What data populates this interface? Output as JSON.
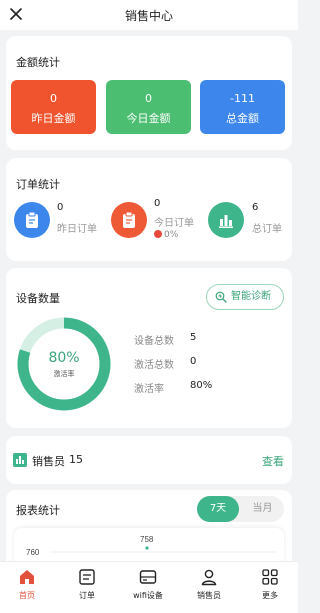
{
  "header": {
    "title": "销售中心"
  },
  "amount": {
    "title": "金额统计",
    "items": [
      {
        "value": "0",
        "label": "昨日金额",
        "color": "#f0542e"
      },
      {
        "value": "0",
        "label": "今日金额",
        "color": "#4cbe72"
      },
      {
        "value": "-111",
        "label": "总金额",
        "color": "#3c86ec"
      }
    ]
  },
  "orders": {
    "title": "订单统计",
    "items": [
      {
        "value": "0",
        "label": "昨日订单",
        "color": "#3c86ec",
        "icon": "clipboard-icon"
      },
      {
        "value": "0",
        "label": "今日订单",
        "color": "#ee5a35",
        "icon": "clipboard-icon",
        "change": "0%"
      },
      {
        "value": "6",
        "label": "总订单",
        "color": "#3eb58b",
        "icon": "bar-chart-icon"
      }
    ]
  },
  "devices": {
    "title": "设备数量",
    "diagnose_label": "智能诊断",
    "ring": {
      "percent": 80,
      "value_text": "80%",
      "label": "激活率",
      "color": "#3eb58b",
      "track": "#d6efe5"
    },
    "stats": [
      {
        "label": "设备总数",
        "value": "5"
      },
      {
        "label": "激活总数",
        "value": "0"
      },
      {
        "label": "激活率",
        "value": "80%"
      }
    ]
  },
  "salesman": {
    "label": "销售员",
    "count": "15",
    "link": "查看"
  },
  "report": {
    "title": "报表统计",
    "tabs": [
      "7天",
      "当月"
    ],
    "axis_label": "760",
    "point_label": "758"
  },
  "tabbar": {
    "items": [
      {
        "label": "首页",
        "icon": "home-icon",
        "active": true
      },
      {
        "label": "订单",
        "icon": "order-icon"
      },
      {
        "label": "wifi设备",
        "icon": "device-icon"
      },
      {
        "label": "销售员",
        "icon": "person-icon"
      },
      {
        "label": "更多",
        "icon": "grid-icon"
      }
    ]
  },
  "colors": {
    "accent": "#3eb58b",
    "tab_active": "#e2513c"
  }
}
